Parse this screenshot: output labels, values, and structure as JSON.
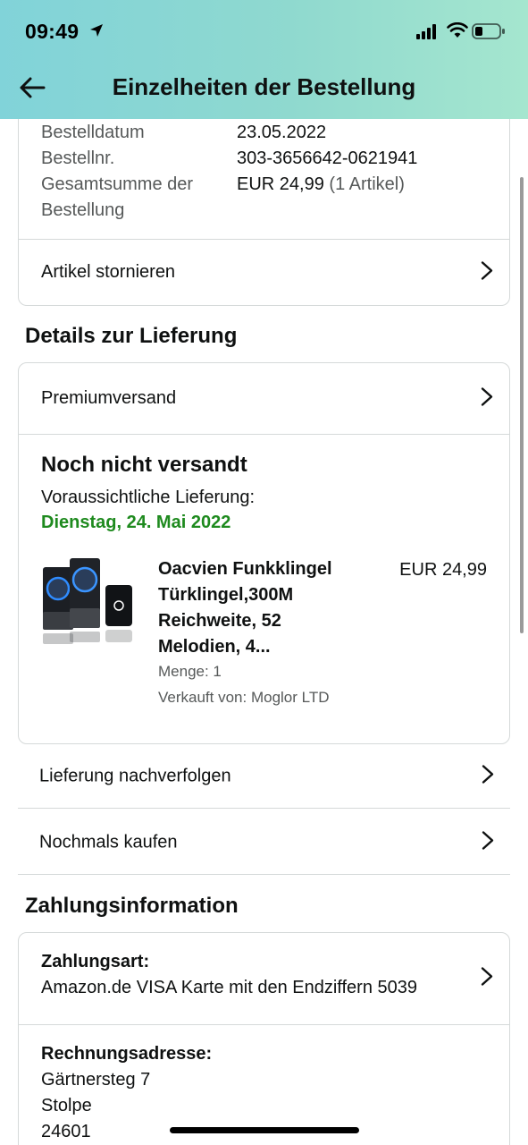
{
  "status_bar": {
    "time": "09:49"
  },
  "header": {
    "title": "Einzelheiten der Bestellung"
  },
  "order_summary": {
    "date_label": "Bestelldatum",
    "date_value": "23.05.2022",
    "number_label": "Bestellnr.",
    "number_value": "303-3656642-0621941",
    "total_label_line1": "Gesamtsumme der",
    "total_label_line2": "Bestellung",
    "total_value": "EUR 24,99",
    "total_items": "(1 Artikel)",
    "cancel_label": "Artikel stornieren"
  },
  "delivery": {
    "section_title": "Details zur Lieferung",
    "shipping_method": "Premiumversand",
    "status": "Noch nicht versandt",
    "expected_label": "Voraussichtliche Lieferung:",
    "expected_date": "Dienstag, 24. Mai 2022",
    "product": {
      "title_lines": [
        "Oacvien Funkklingel",
        "Türklingel,300M",
        "Reichweite, 52",
        "Melodien, 4..."
      ],
      "price": "EUR 24,99",
      "quantity": "Menge: 1",
      "seller": "Verkauft von: Moglor LTD"
    },
    "track_label": "Lieferung nachverfolgen",
    "buy_again_label": "Nochmals kaufen"
  },
  "payment": {
    "section_title": "Zahlungsinformation",
    "method_label": "Zahlungsart:",
    "method_value": "Amazon.de VISA Karte mit den Endziffern 5039",
    "billing_label": "Rechnungsadresse:",
    "billing_lines": [
      "Gärtnersteg 7",
      "Stolpe",
      "24601"
    ]
  },
  "colors": {
    "accent_green": "#1e8a1e",
    "header_gradient_start": "#81d3d9",
    "header_gradient_end": "#a5e6cf"
  }
}
